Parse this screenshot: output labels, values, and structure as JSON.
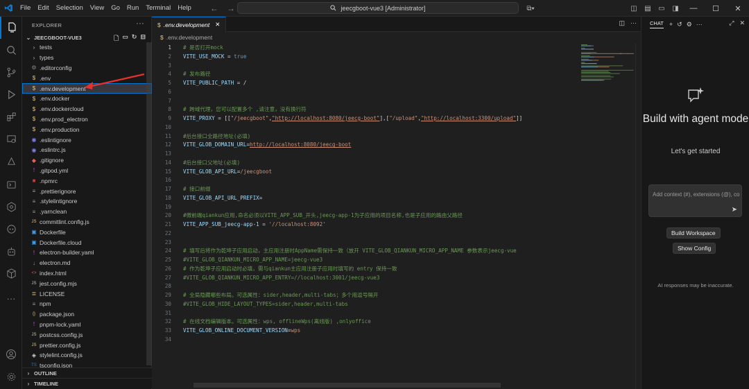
{
  "titlebar": {
    "menu": [
      "File",
      "Edit",
      "Selection",
      "View",
      "Go",
      "Run",
      "Terminal",
      "Help"
    ],
    "search_text": "jeecgboot-vue3 [Administrator]"
  },
  "sidebar": {
    "title": "EXPLORER",
    "project": "JEECGBOOT-VUE3",
    "files": [
      {
        "name": "tests",
        "type": "folder",
        "icon": "chevron-right-icon"
      },
      {
        "name": "types",
        "type": "folder",
        "icon": "chevron-right-icon"
      },
      {
        "name": ".editorconfig",
        "type": "file",
        "icon": "gear-icon"
      },
      {
        "name": ".env",
        "type": "file",
        "icon": "dollar-icon"
      },
      {
        "name": ".env.development",
        "type": "file",
        "icon": "dollar-icon",
        "selected": true
      },
      {
        "name": ".env.docker",
        "type": "file",
        "icon": "dollar-icon"
      },
      {
        "name": ".env.dockercloud",
        "type": "file",
        "icon": "dollar-icon"
      },
      {
        "name": ".env.prod_electron",
        "type": "file",
        "icon": "dollar-icon"
      },
      {
        "name": ".env.production",
        "type": "file",
        "icon": "dollar-icon"
      },
      {
        "name": ".eslintignore",
        "type": "file",
        "icon": "eslint-icon"
      },
      {
        "name": ".eslintrc.js",
        "type": "file",
        "icon": "eslint-icon"
      },
      {
        "name": ".gitignore",
        "type": "file",
        "icon": "git-icon"
      },
      {
        "name": ".gitpod.yml",
        "type": "file",
        "icon": "yaml-icon"
      },
      {
        "name": ".npmrc",
        "type": "file",
        "icon": "npm-icon"
      },
      {
        "name": ".prettierignore",
        "type": "file",
        "icon": "lines-icon"
      },
      {
        "name": ".stylelintignore",
        "type": "file",
        "icon": "lines-icon"
      },
      {
        "name": ".yarnclean",
        "type": "file",
        "icon": "lines-icon"
      },
      {
        "name": "commitlint.config.js",
        "type": "file",
        "icon": "js-icon"
      },
      {
        "name": "Dockerfile",
        "type": "file",
        "icon": "docker-icon"
      },
      {
        "name": "Dockerfile.cloud",
        "type": "file",
        "icon": "docker-icon"
      },
      {
        "name": "electron-builder.yaml",
        "type": "file",
        "icon": "yaml-icon"
      },
      {
        "name": "electron.md",
        "type": "file",
        "icon": "markdown-icon"
      },
      {
        "name": "index.html",
        "type": "file",
        "icon": "html-icon"
      },
      {
        "name": "jest.config.mjs",
        "type": "file",
        "icon": "js-icon"
      },
      {
        "name": "LICENSE",
        "type": "file",
        "icon": "license-icon"
      },
      {
        "name": "npm",
        "type": "file",
        "icon": "lines-icon"
      },
      {
        "name": "package.json",
        "type": "file",
        "icon": "json-icon"
      },
      {
        "name": "pnpm-lock.yaml",
        "type": "file",
        "icon": "yaml-icon"
      },
      {
        "name": "postcss.config.js",
        "type": "file",
        "icon": "js-icon"
      },
      {
        "name": "prettier.config.js",
        "type": "file",
        "icon": "js-icon"
      },
      {
        "name": "stylelint.config.js",
        "type": "file",
        "icon": "stylelint-icon"
      },
      {
        "name": "tsconfig.json",
        "type": "file",
        "icon": "ts-icon"
      }
    ],
    "outline": "OUTLINE",
    "timeline": "TIMELINE"
  },
  "editor": {
    "tab_label": ".env.development",
    "breadcrumb": ".env.development",
    "current_line": 1,
    "lines": [
      {
        "n": 1,
        "parts": [
          {
            "t": "# 是否打开mock",
            "c": "comment"
          }
        ]
      },
      {
        "n": 2,
        "parts": [
          {
            "t": "VITE_USE_MOCK",
            "c": "key"
          },
          {
            "t": " = ",
            "c": "op"
          },
          {
            "t": "true",
            "c": "bool"
          }
        ]
      },
      {
        "n": 3,
        "parts": []
      },
      {
        "n": 4,
        "parts": [
          {
            "t": "# 发布路径",
            "c": "comment"
          }
        ]
      },
      {
        "n": 5,
        "parts": [
          {
            "t": "VITE_PUBLIC_PATH",
            "c": "key"
          },
          {
            "t": " = /",
            "c": "op"
          }
        ]
      },
      {
        "n": 6,
        "parts": []
      },
      {
        "n": 7,
        "parts": []
      },
      {
        "n": 8,
        "parts": [
          {
            "t": "# 跨域代理，您可以配置多个 ,请注意，没有换行符",
            "c": "comment"
          }
        ]
      },
      {
        "n": 9,
        "parts": [
          {
            "t": "VITE_PROXY",
            "c": "key"
          },
          {
            "t": " = [[",
            "c": "op"
          },
          {
            "t": "\"/jeecgboot\"",
            "c": "str"
          },
          {
            "t": ",",
            "c": "op"
          },
          {
            "t": "\"http://localhost:8080/jeecg-boot\"",
            "c": "url"
          },
          {
            "t": "],[",
            "c": "op"
          },
          {
            "t": "\"/upload\"",
            "c": "str"
          },
          {
            "t": ",",
            "c": "op"
          },
          {
            "t": "\"http://localhost:3300/upload\"",
            "c": "url"
          },
          {
            "t": "]]",
            "c": "op"
          }
        ]
      },
      {
        "n": 10,
        "parts": []
      },
      {
        "n": 11,
        "parts": [
          {
            "t": "#后台接口全路径地址(必填)",
            "c": "comment"
          }
        ]
      },
      {
        "n": 12,
        "parts": [
          {
            "t": "VITE_GLOB_DOMAIN_URL",
            "c": "key"
          },
          {
            "t": "=",
            "c": "op"
          },
          {
            "t": "http://localhost:8080/jeecg-boot",
            "c": "url"
          }
        ]
      },
      {
        "n": 13,
        "parts": []
      },
      {
        "n": 14,
        "parts": [
          {
            "t": "#后台接口父地址(必填)",
            "c": "comment"
          }
        ]
      },
      {
        "n": 15,
        "parts": [
          {
            "t": "VITE_GLOB_API_URL",
            "c": "key"
          },
          {
            "t": "=",
            "c": "op"
          },
          {
            "t": "/jeecgboot",
            "c": "val"
          }
        ]
      },
      {
        "n": 16,
        "parts": []
      },
      {
        "n": 17,
        "parts": [
          {
            "t": "# 接口前缀",
            "c": "comment"
          }
        ]
      },
      {
        "n": 18,
        "parts": [
          {
            "t": "VITE_GLOB_API_URL_PREFIX",
            "c": "key"
          },
          {
            "t": "=",
            "c": "op"
          }
        ]
      },
      {
        "n": 19,
        "parts": []
      },
      {
        "n": 20,
        "parts": [
          {
            "t": "#微前端qiankun应用,命名必须以VITE_APP_SUB_开头,jeecg-app-1为子应用的项目名称,也是子应用的路由父路径",
            "c": "comment"
          }
        ]
      },
      {
        "n": 21,
        "parts": [
          {
            "t": "VITE_APP_SUB_jeecg-app-1",
            "c": "key"
          },
          {
            "t": " = ",
            "c": "op"
          },
          {
            "t": "'//localhost:8092'",
            "c": "str"
          }
        ]
      },
      {
        "n": 22,
        "parts": []
      },
      {
        "n": 23,
        "parts": []
      },
      {
        "n": 24,
        "parts": [
          {
            "t": "# 填写后将作为乾坤子应用启动，主应用注册时AppName需保持一致（放开 VITE_GLOB_QIANKUN_MICRO_APP_NAME 参数表示jeecg-vue",
            "c": "comment"
          }
        ]
      },
      {
        "n": 25,
        "parts": [
          {
            "t": "#VITE_GLOB_QIANKUN_MICRO_APP_NAME=jeecg-vue3",
            "c": "comment"
          }
        ]
      },
      {
        "n": 26,
        "parts": [
          {
            "t": "# 作为乾坤子应用启动时必填，需与qiankun主应用注册子应用时填写的 entry 保持一致",
            "c": "comment"
          }
        ]
      },
      {
        "n": 27,
        "parts": [
          {
            "t": "#VITE_GLOB_QIANKUN_MICRO_APP_ENTRY=//localhost:3001/jeecg-vue3",
            "c": "comment"
          }
        ]
      },
      {
        "n": 28,
        "parts": []
      },
      {
        "n": 29,
        "parts": [
          {
            "t": "# 全局隐藏哪些布局。可选属性：sider,header,multi-tabs；多个用逗号隔开",
            "c": "comment"
          }
        ]
      },
      {
        "n": 30,
        "parts": [
          {
            "t": "#VITE_GLOB_HIDE_LAYOUT_TYPES=sider,header,multi-tabs",
            "c": "comment"
          }
        ]
      },
      {
        "n": 31,
        "parts": []
      },
      {
        "n": 32,
        "parts": [
          {
            "t": "# 在线文档编辑版本。可选属性：wps, offlineWps(离线版) ,onlyoffice",
            "c": "comment"
          }
        ]
      },
      {
        "n": 33,
        "parts": [
          {
            "t": "VITE_GLOB_ONLINE_DOCUMENT_VERSION",
            "c": "key"
          },
          {
            "t": "=",
            "c": "op"
          },
          {
            "t": "wps",
            "c": "val"
          }
        ]
      },
      {
        "n": 34,
        "parts": []
      }
    ]
  },
  "chat": {
    "tab_label": "CHAT",
    "title": "Build with agent mode",
    "subtitle": "Let's get started",
    "input_placeholder": "Add context (#), extensions (@), commands (/)",
    "build_workspace": "Build Workspace",
    "show_config": "Show Config",
    "disclaimer": "AI responses may be inaccurate."
  },
  "colors": {
    "accent": "#0078d4",
    "annotation_arrow": "#e5322d"
  }
}
